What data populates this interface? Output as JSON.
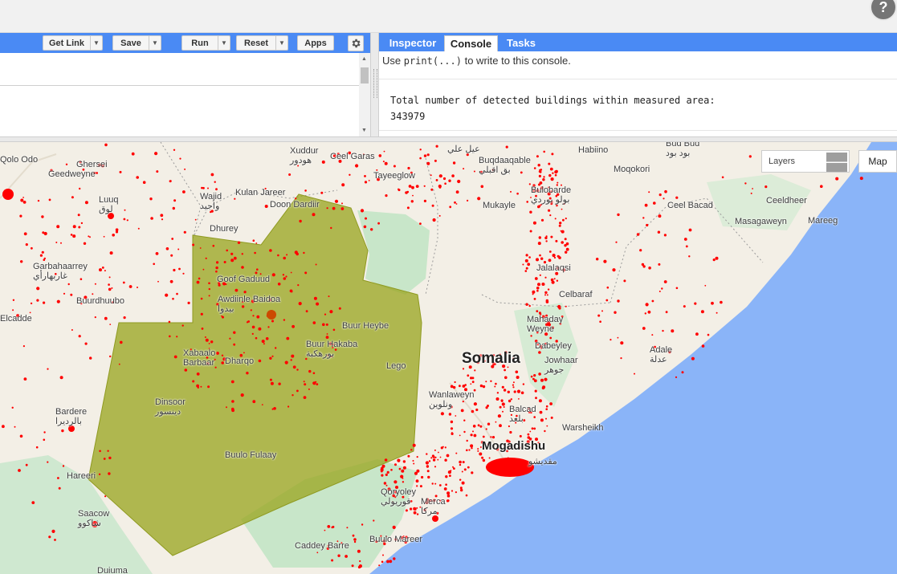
{
  "help": {
    "icon": "help-icon",
    "label": "?"
  },
  "editor": {
    "toolbar": {
      "get_link": "Get Link",
      "save": "Save",
      "run": "Run",
      "reset": "Reset",
      "apps": "Apps",
      "settings_icon": "gear-icon",
      "dropdown_icon": "chevron-down-icon"
    }
  },
  "right_panel": {
    "tabs": [
      "Inspector",
      "Console",
      "Tasks"
    ],
    "active_tab": "Console",
    "console": {
      "hint_prefix": "Use ",
      "hint_code": "print(...)",
      "hint_suffix": " to write to this console.",
      "output_line1": "Total number of detected buildings within measured area:",
      "output_line2": "343979"
    }
  },
  "map": {
    "layers_label": "Layers",
    "map_button": "Map",
    "country_label": "Somalia",
    "capital_label": "Mogadishu",
    "colors": {
      "land": "#f3efe6",
      "ocean": "#8ab4f8",
      "park": "#c8e6c9",
      "aoi_fill": "#9ba624",
      "points": "#ff0000"
    },
    "places": [
      {
        "name": "Xuddur",
        "alt": "هودور"
      },
      {
        "name": "Ceel Garas",
        "alt": ""
      },
      {
        "name": "عيل علي",
        "alt": ""
      },
      {
        "name": "Buqdaaqable",
        "alt": "بق اقبلي"
      },
      {
        "name": "Habiino",
        "alt": ""
      },
      {
        "name": "Bud Bud",
        "alt": "بود بود"
      },
      {
        "name": "Qolo Odo",
        "alt": ""
      },
      {
        "name": "Ghersei",
        "alt": ""
      },
      {
        "name": "Geedweyne",
        "alt": ""
      },
      {
        "name": "Tayeeglow",
        "alt": ""
      },
      {
        "name": "Moqokori",
        "alt": ""
      },
      {
        "name": "Luuq",
        "alt": "لوق"
      },
      {
        "name": "Wajid",
        "alt": "واجيد"
      },
      {
        "name": "Kulan Jareer",
        "alt": ""
      },
      {
        "name": "Doon Dardiir",
        "alt": ""
      },
      {
        "name": "Bulobarde",
        "alt": "بولو بوردي"
      },
      {
        "name": "Mukayle",
        "alt": ""
      },
      {
        "name": "Ceel Bacad",
        "alt": ""
      },
      {
        "name": "Ceeldheer",
        "alt": ""
      },
      {
        "name": "Masagaweyn",
        "alt": ""
      },
      {
        "name": "Mareeg",
        "alt": ""
      },
      {
        "name": "Dhurey",
        "alt": ""
      },
      {
        "name": "Garbahaarrey",
        "alt": "غاربهارأي"
      },
      {
        "name": "Jalalaqsi",
        "alt": ""
      },
      {
        "name": "Goof Gaduud",
        "alt": ""
      },
      {
        "name": "Awdiinle Baidoa",
        "alt": "بيدوا"
      },
      {
        "name": "Celbaraf",
        "alt": ""
      },
      {
        "name": "Buurdhuubo",
        "alt": ""
      },
      {
        "name": "Elcadde",
        "alt": ""
      },
      {
        "name": "Mahaday Weyne",
        "alt": ""
      },
      {
        "name": "Buur Heybe",
        "alt": ""
      },
      {
        "name": "Buur Hakaba",
        "alt": "بورهكبة"
      },
      {
        "name": "Xabaalo Barbaar",
        "alt": ""
      },
      {
        "name": "Dharqo",
        "alt": ""
      },
      {
        "name": "Dabeyley",
        "alt": ""
      },
      {
        "name": "Jowhaar",
        "alt": "جوهر"
      },
      {
        "name": "Adale",
        "alt": "عدلة"
      },
      {
        "name": "Lego",
        "alt": ""
      },
      {
        "name": "Wanlaweyn",
        "alt": "ونلوين"
      },
      {
        "name": "Dinsoor",
        "alt": "دينسور"
      },
      {
        "name": "Bardere",
        "alt": "بالرديرا"
      },
      {
        "name": "Balcad",
        "alt": "بلعد"
      },
      {
        "name": "Warsheikh",
        "alt": ""
      },
      {
        "name": "Mogadishu",
        "alt": "مقديشو"
      },
      {
        "name": "Buulo Fulaay",
        "alt": ""
      },
      {
        "name": "Hareeri",
        "alt": ""
      },
      {
        "name": "Qoryoley",
        "alt": "قوريولي"
      },
      {
        "name": "Merca",
        "alt": "مركا"
      },
      {
        "name": "Saacow",
        "alt": "شاكوو"
      },
      {
        "name": "Buulo Mareer",
        "alt": ""
      },
      {
        "name": "Caddey Barre",
        "alt": ""
      },
      {
        "name": "Duiuma",
        "alt": ""
      }
    ]
  }
}
